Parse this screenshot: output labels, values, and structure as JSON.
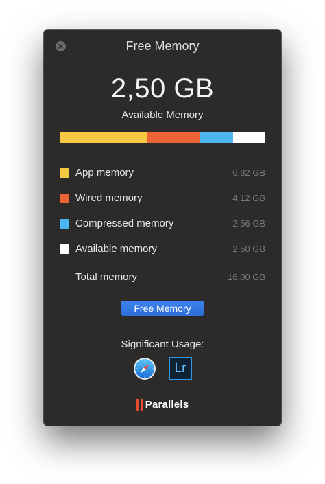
{
  "window": {
    "title": "Free Memory"
  },
  "summary": {
    "available_value": "2,50 GB",
    "available_caption": "Available Memory"
  },
  "memory_bar": {
    "segments": [
      {
        "name": "App memory",
        "gb": 6.82,
        "color": "#f6c945"
      },
      {
        "name": "Wired memory",
        "gb": 4.12,
        "color": "#ec6436"
      },
      {
        "name": "Compressed memory",
        "gb": 2.56,
        "color": "#4bb6f0"
      },
      {
        "name": "Available memory",
        "gb": 2.5,
        "color": "#ffffff"
      }
    ]
  },
  "legend": {
    "items": [
      {
        "label": "App memory",
        "value": "6,82 GB",
        "color": "#f6c945"
      },
      {
        "label": "Wired memory",
        "value": "4,12 GB",
        "color": "#ec6436"
      },
      {
        "label": "Compressed memory",
        "value": "2,56 GB",
        "color": "#4bb6f0"
      },
      {
        "label": "Available memory",
        "value": "2,50 GB",
        "color": "#ffffff"
      }
    ],
    "total_label": "Total memory",
    "total_value": "16,00 GB"
  },
  "actions": {
    "free_memory_label": "Free Memory"
  },
  "significant_usage": {
    "label": "Significant Usage:",
    "apps": [
      {
        "name": "Safari",
        "icon": "safari-compass-icon"
      },
      {
        "name": "Lightroom",
        "icon": "lightroom-icon",
        "glyph": "Lr"
      }
    ]
  },
  "footer": {
    "brand": "Parallels",
    "brand_color": "#e84a32"
  }
}
